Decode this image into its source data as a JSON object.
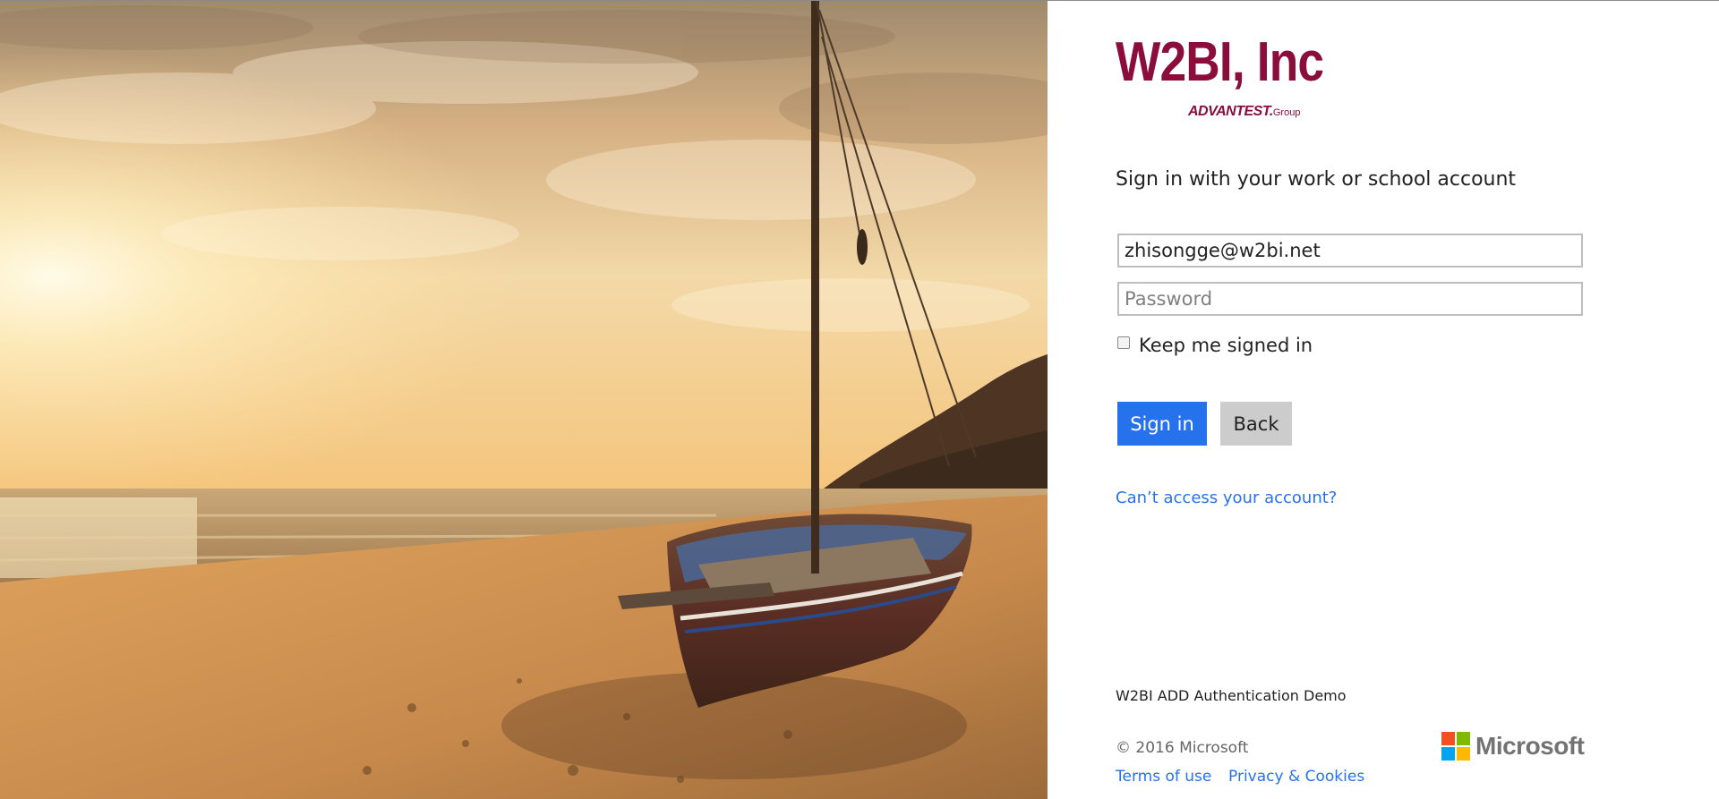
{
  "brand": {
    "logo_main": "W2BI, Inc",
    "logo_sub": "ADVANTEST.",
    "logo_sub_suffix": "Group",
    "logo_color": "#8b0d3a"
  },
  "form": {
    "heading": "Sign in with your work or school account",
    "email_value": "zhisongge@w2bi.net",
    "password_placeholder": "Password",
    "keep_signed_in_label": "Keep me signed in",
    "keep_signed_in_checked": false,
    "sign_in_label": "Sign in",
    "back_label": "Back",
    "cant_access_label": "Can’t access your account?"
  },
  "footer": {
    "demo_text": "W2BI ADD Authentication Demo",
    "copyright": "© 2016 Microsoft",
    "terms_label": "Terms of use",
    "privacy_label": "Privacy & Cookies",
    "microsoft_label": "Microsoft"
  },
  "colors": {
    "accent": "#2672ec",
    "back_button": "#cccccc",
    "ms_red": "#f25022",
    "ms_green": "#7fba00",
    "ms_blue": "#00a4ef",
    "ms_yellow": "#ffb900"
  },
  "illustration": {
    "subject": "sunset-beach-boat"
  }
}
